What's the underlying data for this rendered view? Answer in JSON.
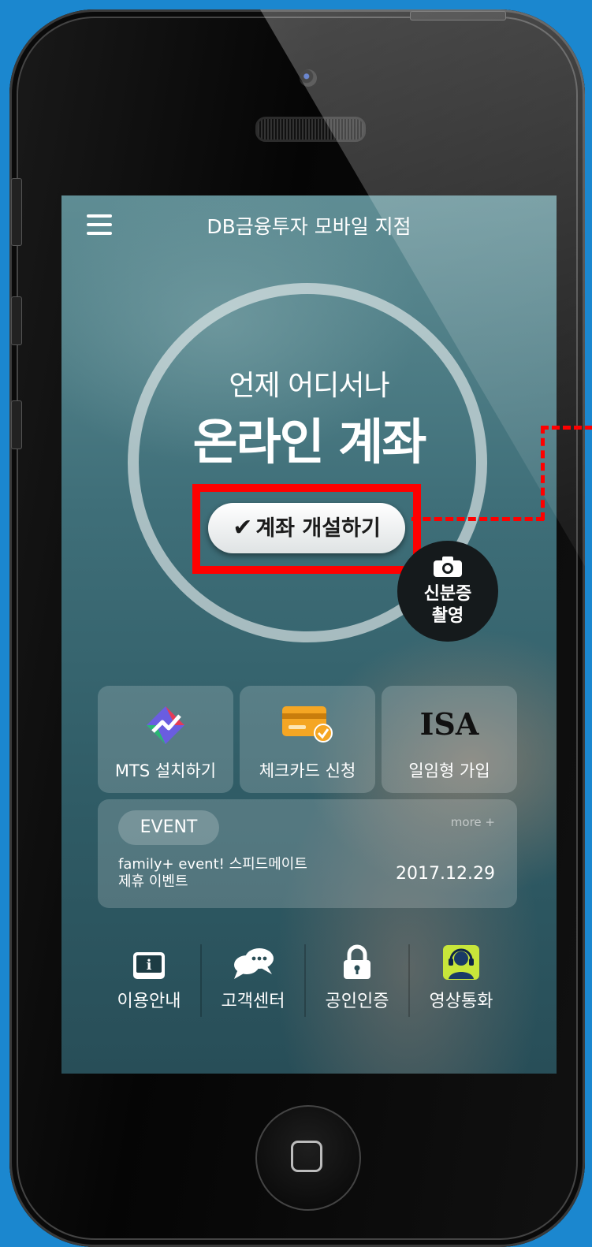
{
  "header": {
    "title": "DB금융투자 모바일 지점"
  },
  "hero": {
    "subtitle": "언제 어디서나",
    "title": "온라인 계좌",
    "open_check": "✔",
    "open_label": "계좌 개설하기"
  },
  "id_capture": {
    "line1": "신분증",
    "line2": "촬영"
  },
  "quick_menu": [
    {
      "label": "MTS 설치하기",
      "icon": "mts-logo-icon"
    },
    {
      "label": "체크카드 신청",
      "icon": "card-icon"
    },
    {
      "label": "일임형 가입",
      "icon": "isa-icon",
      "icon_text": "ISA"
    }
  ],
  "event": {
    "badge": "EVENT",
    "more": "more +",
    "line1": "family+ event! 스피드메이트",
    "line2": "제휴 이벤트",
    "date": "2017.12.29"
  },
  "utility": [
    {
      "label": "이용안내",
      "icon": "info-book-icon"
    },
    {
      "label": "고객센터",
      "icon": "chat-bubble-icon"
    },
    {
      "label": "공인인증",
      "icon": "lock-icon"
    },
    {
      "label": "영상통화",
      "icon": "headset-icon"
    }
  ],
  "colors": {
    "background": "#1b87cf",
    "highlight": "#ff0000"
  }
}
